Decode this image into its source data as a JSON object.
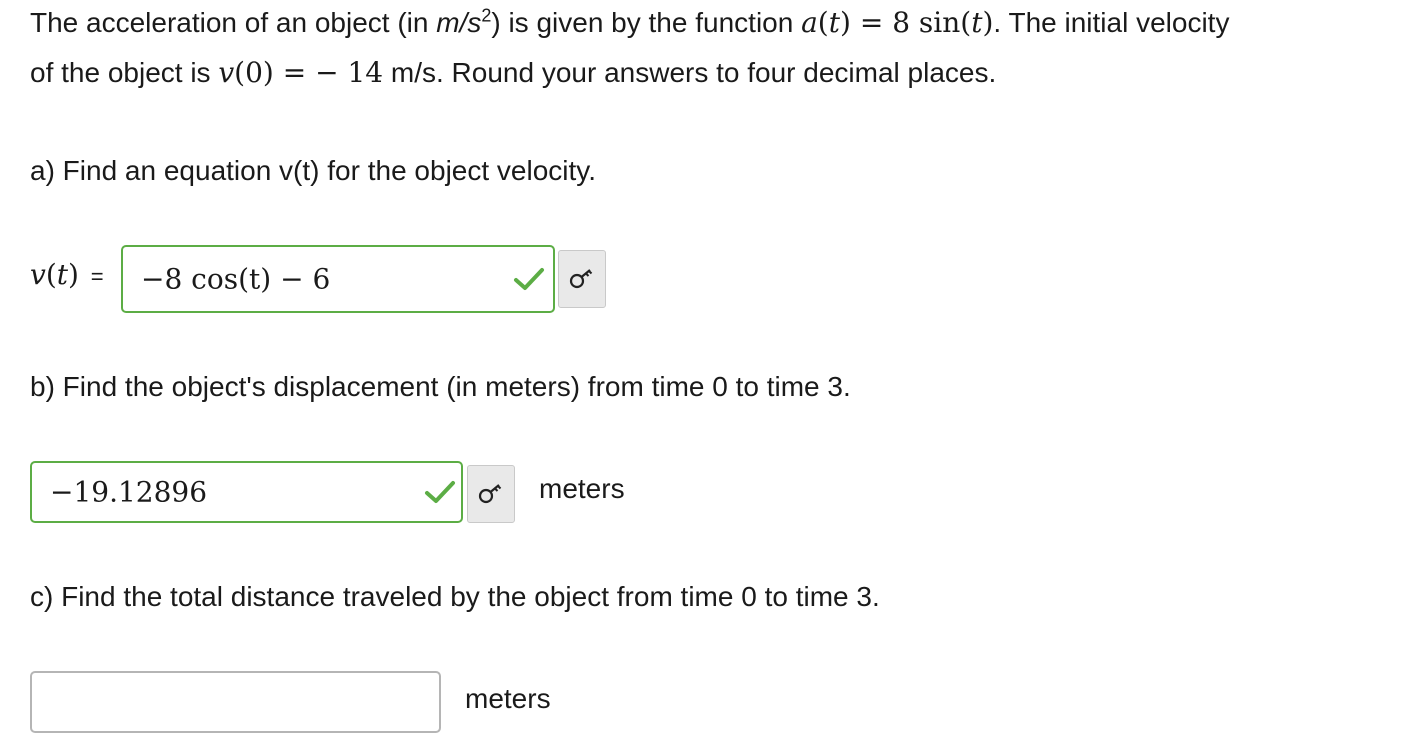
{
  "problem": {
    "intro_1": "The acceleration of an object (in ",
    "unit_m": "m/s",
    "unit_exp": "2",
    "intro_2": ") is given by the function ",
    "fn_a": "a",
    "fn_t": "t",
    "fn_rhs": " = 8 sin(",
    "fn_end": ")",
    "intro_3": ". The initial velocity",
    "line2_1": "of the object is ",
    "v0_v": "v",
    "v0_rest": "(0)  =  − 14",
    "line2_2": " m/s. Round your answers to four decimal places."
  },
  "part_a": {
    "prompt": "a) Find an equation v(t) for the object velocity.",
    "label_v": "v",
    "label_t": "t",
    "equals": "=",
    "answer_value": "−8 cos(t) − 6",
    "status": "correct"
  },
  "part_b": {
    "prompt": "b) Find the object's displacement (in meters) from time 0 to time 3.",
    "answer_value": "−19.12896",
    "unit": "meters",
    "status": "correct"
  },
  "part_c": {
    "prompt": "c) Find the total distance traveled by the object from time 0 to time 3.",
    "answer_value": "",
    "unit": "meters",
    "status": "empty"
  },
  "icons": {
    "check": "checkmark-icon",
    "key": "key-icon"
  },
  "colors": {
    "correct_green": "#5cad45",
    "text": "#1a1a1a",
    "button_bg": "#e9e9e9",
    "empty_border": "#b5b5b5"
  }
}
